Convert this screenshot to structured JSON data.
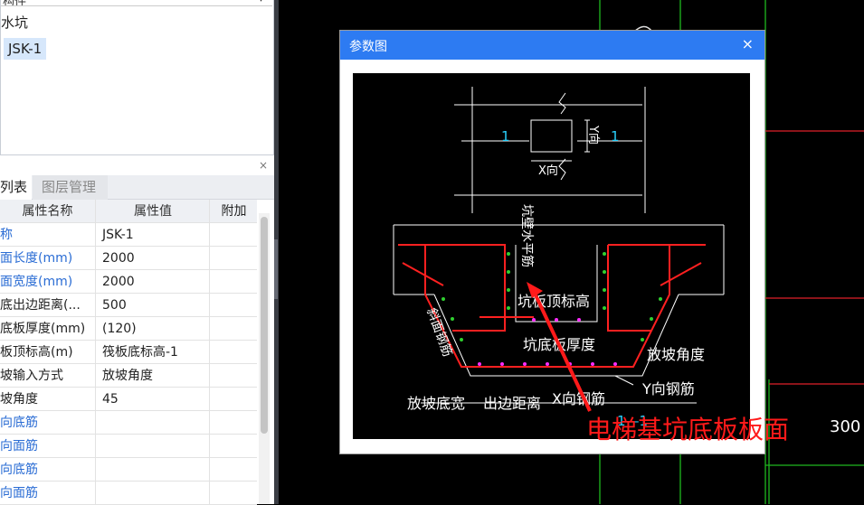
{
  "tree": {
    "top_partial": "构件",
    "parent": "水坑",
    "child": "JSK-1"
  },
  "tabs": {
    "active": "列表",
    "inactive": "图层管理",
    "close": "×"
  },
  "table": {
    "headers": [
      "属性名称",
      "属性值",
      "附加"
    ],
    "rows": [
      {
        "name": "称",
        "value": "JSK-1",
        "blue": true,
        "checkbox": false
      },
      {
        "name": "面长度(mm)",
        "value": "2000",
        "blue": true,
        "checkbox": true
      },
      {
        "name": "面宽度(mm)",
        "value": "2000",
        "blue": true,
        "checkbox": true
      },
      {
        "name": "底出边距离(...",
        "value": "500",
        "blue": false,
        "checkbox": true
      },
      {
        "name": "底板厚度(mm)",
        "value": "(120)",
        "blue": false,
        "checkbox": true
      },
      {
        "name": "板顶标高(m)",
        "value": "筏板底标高-1",
        "blue": false,
        "checkbox": true
      },
      {
        "name": "坡输入方式",
        "value": "放坡角度",
        "blue": false,
        "checkbox": true
      },
      {
        "name": "坡角度",
        "value": "45",
        "blue": false,
        "checkbox": true
      },
      {
        "name": "向底筋",
        "value": "",
        "blue": true,
        "checkbox": true
      },
      {
        "name": "向面筋",
        "value": "",
        "blue": true,
        "checkbox": true
      },
      {
        "name": "向底筋",
        "value": "",
        "blue": true,
        "checkbox": true
      },
      {
        "name": "向面筋",
        "value": "",
        "blue": true,
        "checkbox": true
      }
    ]
  },
  "dialog": {
    "title": "参数图",
    "close": "×"
  },
  "diagram": {
    "label_1_left": "1",
    "label_1_right": "1",
    "label_y": "Y向",
    "label_x": "X向",
    "wall_horizontal": "坑壁水平筋",
    "top_elev": "坑板顶标高",
    "bottom_thick": "坑底板厚度",
    "slope_angle": "放坡角度",
    "slope_rebar": "斜面钢筋",
    "y_rebar": "Y向钢筋",
    "slope_width": "放坡底宽",
    "edge_dist": "出边距离",
    "x_rebar": "X向钢筋",
    "section": "1—1"
  },
  "annotation": {
    "text": "电梯基坑底板板面",
    "color": "#ff1a1a"
  },
  "cad": {
    "number": "300"
  }
}
